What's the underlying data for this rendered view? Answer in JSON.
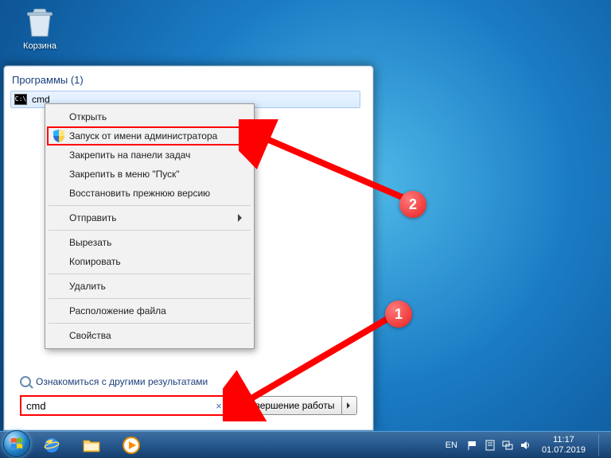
{
  "desktop": {
    "recycle_label": "Корзина"
  },
  "start_menu": {
    "section_programs": "Программы (1)",
    "result_name": "cmd",
    "see_more": "Ознакомиться с другими результатами",
    "shutdown_label": "Завершение работы"
  },
  "search": {
    "value": "cmd",
    "clear_glyph": "×"
  },
  "context_menu": {
    "open": "Открыть",
    "run_admin": "Запуск от имени администратора",
    "pin_taskbar": "Закрепить на панели задач",
    "pin_start": "Закрепить в меню \"Пуск\"",
    "restore_prev": "Восстановить прежнюю версию",
    "send_to": "Отправить",
    "cut": "Вырезать",
    "copy": "Копировать",
    "delete": "Удалить",
    "open_location": "Расположение файла",
    "properties": "Свойства"
  },
  "annotations": {
    "badge1": "1",
    "badge2": "2"
  },
  "taskbar": {
    "lang": "EN",
    "time": "11:17",
    "date": "01.07.2019"
  },
  "colors": {
    "highlight": "#ff0000",
    "link": "#1a3e7b"
  }
}
